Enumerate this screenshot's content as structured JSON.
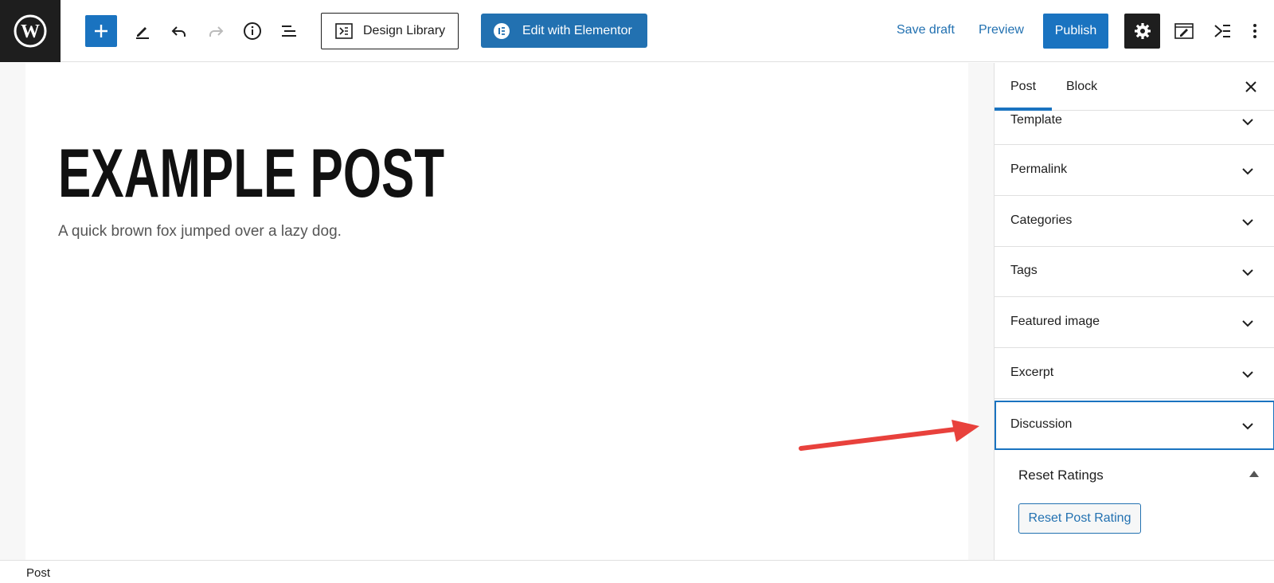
{
  "toolbar": {
    "design_library_label": "Design Library",
    "edit_elementor_label": "Edit with Elementor",
    "save_draft_label": "Save draft",
    "preview_label": "Preview",
    "publish_label": "Publish"
  },
  "post": {
    "title": "EXAMPLE POST",
    "body": "A quick brown fox jumped over a lazy dog."
  },
  "sidebar": {
    "tabs": [
      {
        "label": "Post",
        "active": true
      },
      {
        "label": "Block",
        "active": false
      }
    ],
    "panels": [
      {
        "label": "Template"
      },
      {
        "label": "Permalink"
      },
      {
        "label": "Categories"
      },
      {
        "label": "Tags"
      },
      {
        "label": "Featured image"
      },
      {
        "label": "Excerpt"
      },
      {
        "label": "Discussion",
        "focused": true
      }
    ],
    "reset_ratings_title": "Reset Ratings",
    "reset_button_label": "Reset Post Rating"
  },
  "footer": {
    "breadcrumb": "Post"
  },
  "colors": {
    "accent": "#1a73c0",
    "annotation_arrow": "#e8413c"
  }
}
